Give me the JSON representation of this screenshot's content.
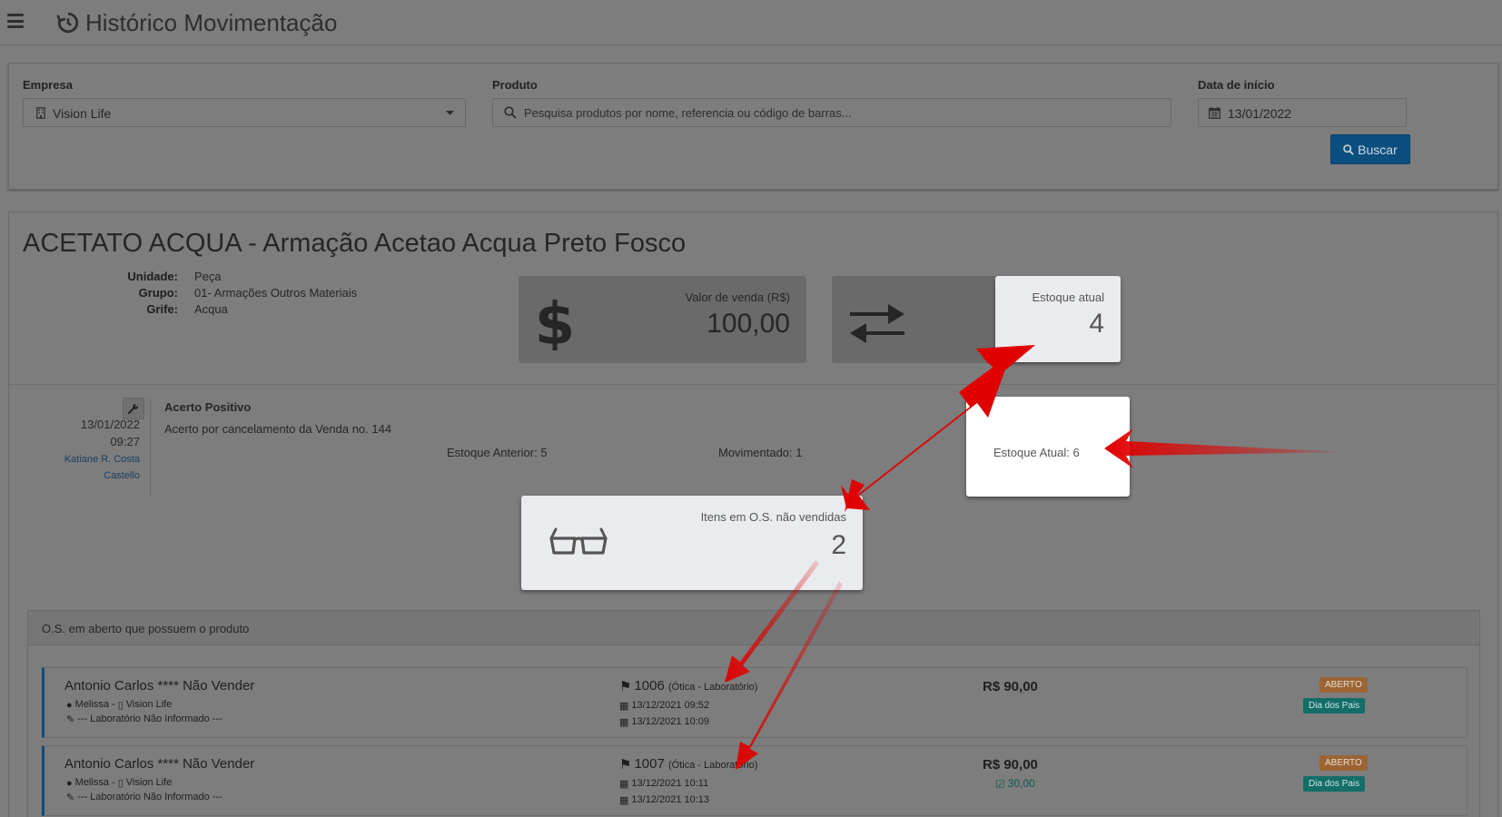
{
  "header": {
    "title": "Histórico Movimentação",
    "menu_icon": "hamburger-icon",
    "title_icon": "history-icon"
  },
  "filters": {
    "empresa": {
      "label": "Empresa",
      "value": "Vision Life"
    },
    "produto": {
      "label": "Produto",
      "placeholder": "Pesquisa produtos por nome, referencia ou código de barras..."
    },
    "data_inicio": {
      "label": "Data de início",
      "value": "13/01/2022"
    },
    "search_button": "Buscar"
  },
  "product": {
    "title": "ACETATO ACQUA - Armação Acetao Acqua Preto Fosco",
    "unidade_label": "Unidade:",
    "unidade": "Peça",
    "grupo_label": "Grupo:",
    "grupo": "01- Armações Outros Materiais",
    "grife_label": "Grife:",
    "grife": "Acqua"
  },
  "stats": {
    "valor_venda": {
      "label": "Valor de venda (R$)",
      "value": "100,00"
    },
    "estoque_atual": {
      "label": "Estoque atual",
      "value": "4"
    },
    "itens_os": {
      "label": "Itens em O.S. não vendidas",
      "value": "2"
    }
  },
  "movement": {
    "date": "13/01/2022",
    "time": "09:27",
    "user_line1": "Katiane R. Costa",
    "user_line2": "Castello",
    "type": "Acerto Positivo",
    "description": "Acerto por cancelamento da Venda no. 144",
    "estoque_anterior": "Estoque Anterior: 5",
    "movimentado": "Movimentado: 1",
    "estoque_atual": "Estoque Atual: 6"
  },
  "os_section": {
    "title": "O.S. em aberto que possuem o produto",
    "rows": [
      {
        "client": "Antonio Carlos **** Não Vender",
        "seller": "Melissa -",
        "company": "Vision Life",
        "lab": "--- Laboratório Não Informado ---",
        "number": "1006",
        "origin": "(Ótica - Laboratório)",
        "date1": "13/12/2021 09:52",
        "date2": "13/12/2021 10:09",
        "price": "R$ 90,00",
        "paid": "",
        "status": "ABERTO",
        "campaign": "Dia dos Pais"
      },
      {
        "client": "Antonio Carlos **** Não Vender",
        "seller": "Melissa -",
        "company": "Vision Life",
        "lab": "--- Laboratório Não Informado ---",
        "number": "1007",
        "origin": "(Ótica - Laboratório)",
        "date1": "13/12/2021 10:11",
        "date2": "13/12/2021 10:13",
        "price": "R$ 90,00",
        "paid": "30,00",
        "status": "ABERTO",
        "campaign": "Dia dos Pais"
      }
    ]
  },
  "colors": {
    "overlay": "#7d7d7d",
    "primary": "#0b4f7e",
    "annotation_arrow": "#e00000",
    "badge_open": "#9b6434",
    "badge_campaign": "#136d68"
  }
}
